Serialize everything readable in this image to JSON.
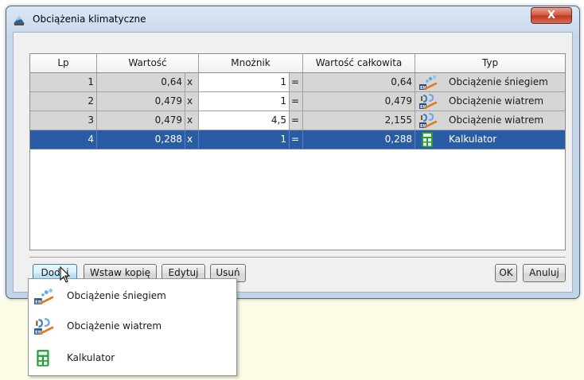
{
  "window": {
    "title": "Obciążenia klimatyczne",
    "close_label": "X"
  },
  "grid": {
    "columns": [
      "Lp",
      "Wartość",
      "Mnożnik",
      "Wartość całkowita",
      "Typ"
    ],
    "rows": [
      {
        "lp": "1",
        "value": "0,64",
        "x": "x",
        "multiplier": "1",
        "eq": "=",
        "total": "0,64",
        "type": "Obciążenie śniegiem",
        "icon": "snow-load-icon"
      },
      {
        "lp": "2",
        "value": "0,479",
        "x": "x",
        "multiplier": "1",
        "eq": "=",
        "total": "0,479",
        "type": "Obciążenie wiatrem",
        "icon": "wind-load-icon"
      },
      {
        "lp": "3",
        "value": "0,479",
        "x": "x",
        "multiplier": "4,5",
        "eq": "=",
        "total": "2,155",
        "type": "Obciążenie wiatrem",
        "icon": "wind-load-icon"
      },
      {
        "lp": "4",
        "value": "0,288",
        "x": "x",
        "multiplier": "1",
        "eq": "=",
        "total": "0,288",
        "type": "Kalkulator",
        "icon": "calculator-icon",
        "selected": true
      }
    ]
  },
  "buttons": {
    "add": "Dodaj",
    "insert_copy": "Wstaw kopię",
    "edit": "Edytuj",
    "delete": "Usuń",
    "ok": "OK",
    "cancel": "Anuluj"
  },
  "popup_menu": {
    "items": [
      {
        "label": "Obciążenie śniegiem",
        "icon": "snow-load-icon"
      },
      {
        "label": "Obciążenie wiatrem",
        "icon": "wind-load-icon"
      },
      {
        "label": "Kalkulator",
        "icon": "calculator-icon"
      }
    ]
  },
  "colors": {
    "selection": "#2a5ba5",
    "readonly_cell": "#d6d6d6",
    "close_button": "#c0371f",
    "calculator_green": "#2a9a3a"
  }
}
